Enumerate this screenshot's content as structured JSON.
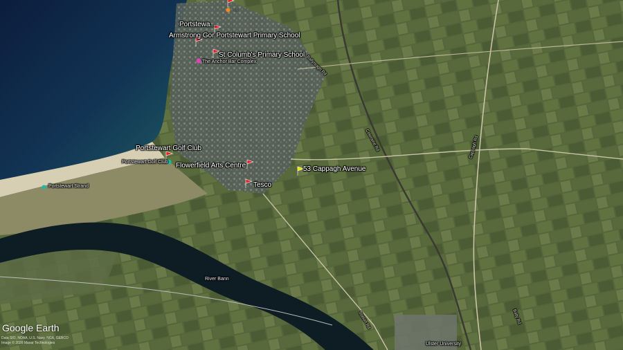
{
  "map": {
    "places": {
      "top_partial": "...",
      "portstewart_center": "Portstewa...",
      "primary_school": "Armstrong Gor Portstewart Primary School",
      "st_columbs": "St Columb's Primary School",
      "anchor_complex": "The Anchor Bar Complex",
      "golf_club": "Portstewart Golf Club",
      "golf_club_small": "Portstewart Golf Club",
      "flowerfield": "Flowerfield Arts Centre",
      "tesco": "Tesco",
      "cappagh": "53 Cappagh Avenue",
      "strand": "Portstewart Strand",
      "river_bann": "River Bann",
      "ulster_uni": "Ulster University"
    },
    "roads": {
      "r1": "Coleraine Rd",
      "r2": "Cappagh Rd",
      "r3": "Bally Rd",
      "r4": "Ballyreagh Rd",
      "r5": "Station Rd"
    },
    "branding": {
      "logo_text": "Google Earth",
      "credits_line1": "Data SIO, NOAA, U.S. Navy, NGA, GEBCO",
      "credits_line2": "Image © 2026 Maxar Technologies"
    },
    "pin_colors": {
      "red": "#e0242b",
      "yellow": "#f2e200"
    }
  }
}
